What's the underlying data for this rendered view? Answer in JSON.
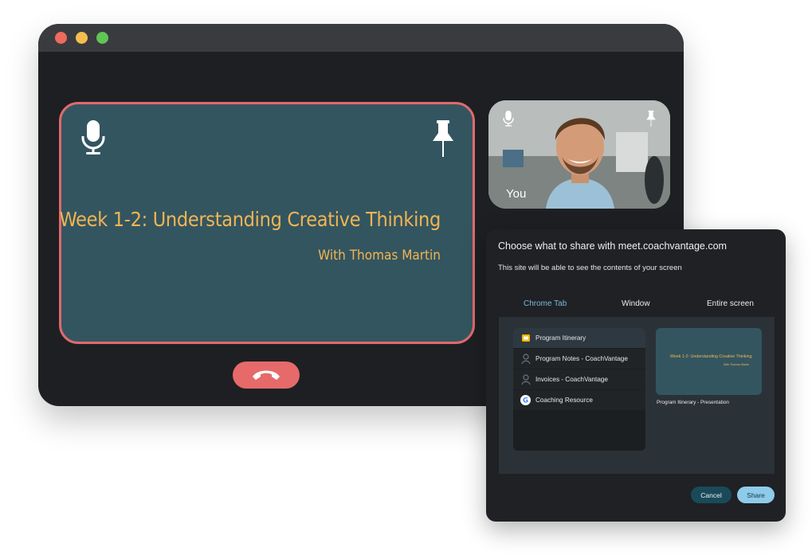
{
  "call": {
    "slide_title": "Week 1-2: Understanding Creative Thinking",
    "slide_subtitle": "With Thomas Martin",
    "self_label": "You"
  },
  "share_dialog": {
    "title": "Choose what to share with meet.coachvantage.com",
    "subtitle": "This site will be able to see the contents of your screen",
    "tabs": [
      {
        "label": "Chrome Tab",
        "active": true
      },
      {
        "label": "Window",
        "active": false
      },
      {
        "label": "Entire screen",
        "active": false
      }
    ],
    "items": [
      {
        "label": "Program Itinerary",
        "icon": "slides-icon",
        "selected": true
      },
      {
        "label": "Program Notes - CoachVantage",
        "icon": "coachvantage-icon",
        "selected": false
      },
      {
        "label": "Invoices - CoachVantage",
        "icon": "coachvantage-icon",
        "selected": false
      },
      {
        "label": "Coaching Resource",
        "icon": "google-icon",
        "selected": false
      }
    ],
    "preview": {
      "title": "Week 1-2: Understanding Creative Thinking",
      "subtitle": "With Thomas Martin",
      "caption": "Program Itinerary - Presentation"
    },
    "cancel_label": "Cancel",
    "share_label": "Share"
  },
  "colors": {
    "window_bg": "#1e1f22",
    "slide_bg": "#335560",
    "slide_border": "#e06a6d",
    "slide_text": "#f2b552",
    "hangup": "#e66a6a",
    "tab_active": "#7ab8de",
    "share_button": "#8ecbea",
    "cancel_button": "#1a4a5a"
  }
}
